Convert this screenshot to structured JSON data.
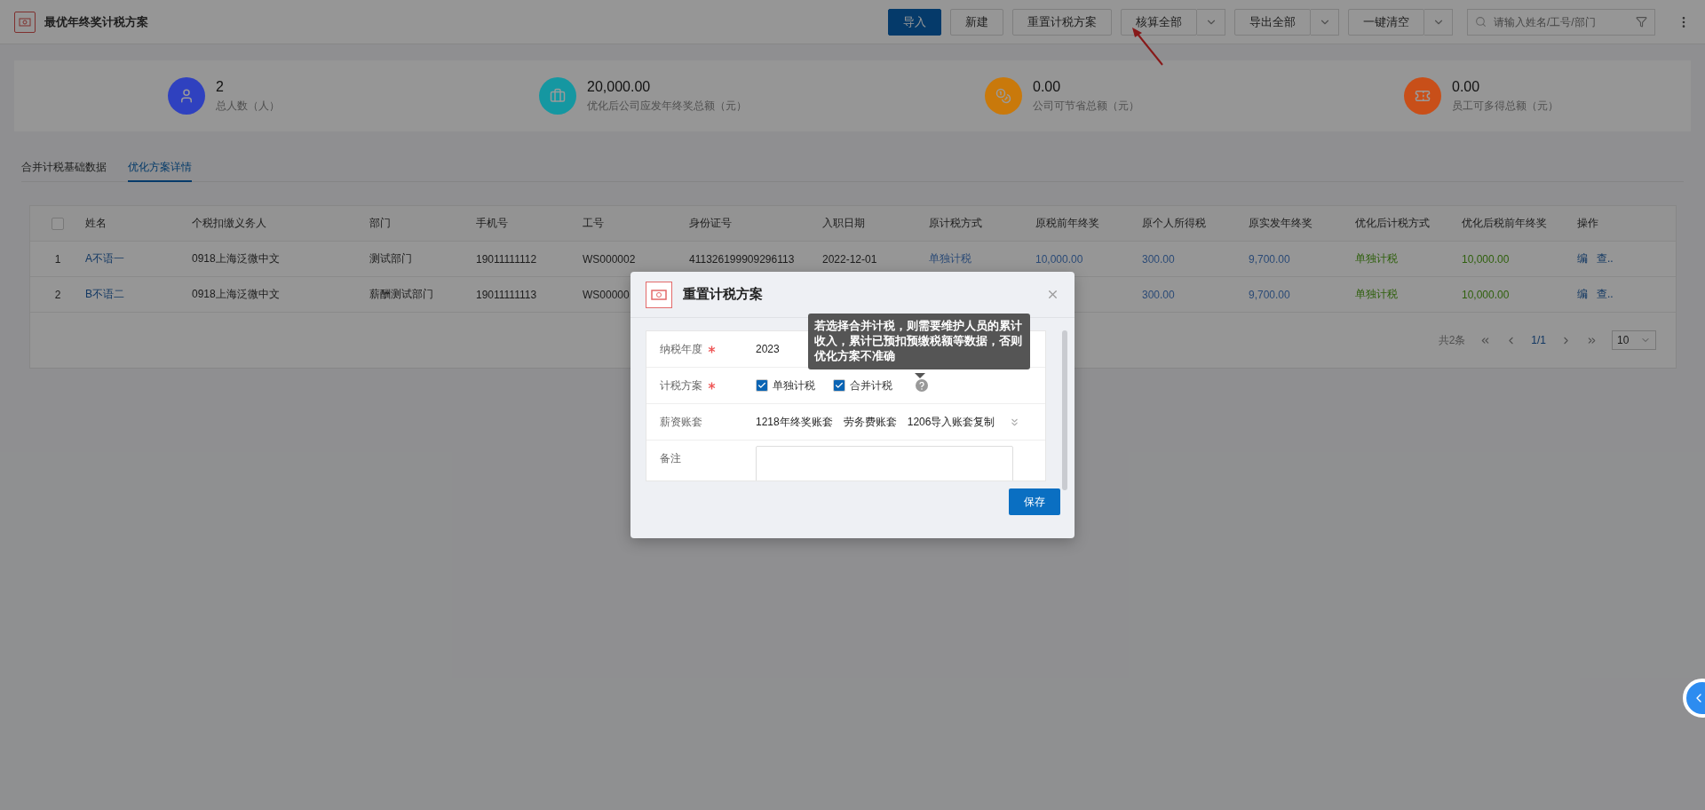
{
  "header": {
    "title": "最优年终奖计税方案",
    "buttons": [
      {
        "label": "导入",
        "kind": "primary"
      },
      {
        "label": "新建",
        "kind": "plain"
      },
      {
        "label": "重置计税方案",
        "kind": "plain"
      },
      {
        "label": "核算全部",
        "kind": "split"
      },
      {
        "label": "导出全部",
        "kind": "split"
      },
      {
        "label": "一键清空",
        "kind": "split"
      }
    ],
    "search": {
      "placeholder": "请输入姓名/工号/部门"
    }
  },
  "stats": [
    {
      "value": "2",
      "label": "总人数（人）",
      "color": "#2f41bf"
    },
    {
      "value": "20,000.00",
      "label": "优化后公司应发年终奖总额（元）",
      "color": "#1597a1"
    },
    {
      "value": "0.00",
      "label": "公司可节省总额（元）",
      "color": "#c9790b"
    },
    {
      "value": "0.00",
      "label": "员工可多得总额（元）",
      "color": "#c84f19"
    }
  ],
  "tabs": [
    {
      "label": "合并计税基础数据",
      "selected": false
    },
    {
      "label": "优化方案详情",
      "selected": true
    }
  ],
  "table": {
    "select_all": {
      "checked": false
    },
    "columns": [
      {
        "label": "姓名",
        "kind": "link"
      },
      {
        "label": "个税扣缴义务人",
        "kind": "plain"
      },
      {
        "label": "部门",
        "kind": "plain"
      },
      {
        "label": "手机号",
        "kind": "plain"
      },
      {
        "label": "工号",
        "kind": "plain"
      },
      {
        "label": "身份证号",
        "kind": "plain"
      },
      {
        "label": "入职日期",
        "kind": "plain"
      },
      {
        "label": "原计税方式",
        "kind": "blue"
      },
      {
        "label": "原税前年终奖",
        "kind": "blue"
      },
      {
        "label": "原个人所得税",
        "kind": "blue"
      },
      {
        "label": "原实发年终奖",
        "kind": "blue"
      },
      {
        "label": "优化后计税方式",
        "kind": "green"
      },
      {
        "label": "优化后税前年终奖",
        "kind": "green"
      },
      {
        "label": "操作",
        "kind": "actions"
      }
    ],
    "rows": [
      {
        "index": "1",
        "cells": [
          "A不语一",
          "0918上海泛微中文",
          "测试部门",
          "19011111112",
          "WS000002",
          "411326199909296113",
          "2022-12-01",
          "单独计税",
          "10,000.00",
          "300.00",
          "9,700.00",
          "单独计税",
          "10,000.00"
        ],
        "actions": [
          "编",
          "查.."
        ]
      },
      {
        "index": "2",
        "cells": [
          "B不语二",
          "0918上海泛微中文",
          "薪酬测试部门",
          "19011111113",
          "WS00000",
          null,
          null,
          null,
          null,
          "300.00",
          "9,700.00",
          "单独计税",
          "10,000.00"
        ],
        "actions": [
          "编",
          "查.."
        ]
      }
    ],
    "pagination": {
      "total": "共2条",
      "page": "1/1",
      "page_size": "10"
    }
  },
  "dialog": {
    "title": "重置计税方案",
    "fields": [
      {
        "label": "纳税年度",
        "required": true,
        "kind": "text",
        "value": "2023"
      },
      {
        "label": "计税方案",
        "required": true,
        "kind": "checkboxes",
        "options": [
          {
            "label": "单独计税",
            "checked": true
          },
          {
            "label": "合并计税",
            "checked": true
          }
        ]
      },
      {
        "label": "薪资账套",
        "required": false,
        "kind": "tags",
        "tags": [
          "1218年终奖账套",
          "劳务费账套",
          "1206导入账套复制"
        ]
      },
      {
        "label": "备注",
        "required": false,
        "kind": "textarea"
      }
    ],
    "tooltip": "若选择合并计税，则需要维护人员的累计收入，累计已预扣预缴税额等数据，否则优化方案不准确",
    "save": "保存"
  }
}
